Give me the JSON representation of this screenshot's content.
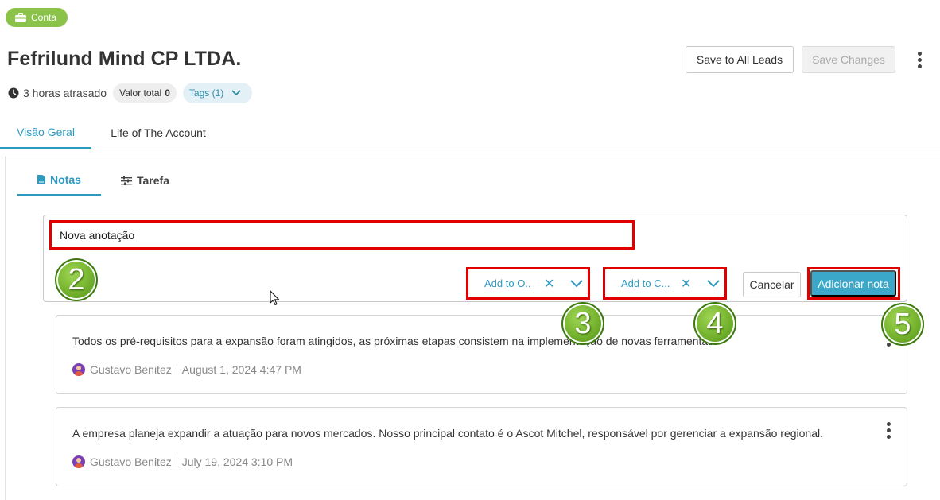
{
  "header": {
    "badge_label": "Conta",
    "title": "Fefrilund Mind CP LTDA.",
    "save_to_all_leads": "Save to All Leads",
    "save_changes": "Save Changes",
    "late_text": "3 horas atrasado",
    "valor_label": "Valor total",
    "valor_value": "0",
    "tags_label": "Tags (1)"
  },
  "main_tabs": [
    {
      "label": "Visão Geral",
      "active": true
    },
    {
      "label": "Life of The Account",
      "active": false
    }
  ],
  "sub_tabs": [
    {
      "label": "Notas",
      "active": true
    },
    {
      "label": "Tarefa",
      "active": false
    }
  ],
  "editor": {
    "value": "Nova anotação",
    "selector_o": "Add to O..",
    "selector_c": "Add to C...",
    "cancel": "Cancelar",
    "add_note": "Adicionar nota"
  },
  "markers": [
    "2",
    "3",
    "4",
    "5"
  ],
  "notes": [
    {
      "text": "Todos os pré-requisitos para a expansão foram atingidos, as próximas etapas consistem na implementação de novas ferramentas.",
      "author": "Gustavo Benitez",
      "date": "August 1, 2024 4:47 PM"
    },
    {
      "text": "A empresa planeja expandir a atuação para novos mercados. Nosso principal contato é o Ascot Mitchel, responsável por gerenciar a expansão regional.",
      "author": "Gustavo Benitez",
      "date": "July 19, 2024 3:10 PM"
    }
  ],
  "colors": {
    "accent": "#2f9ac0",
    "badge_green": "#8bc34a",
    "highlight_red": "#e00000",
    "primary_button": "#3ba7c9"
  }
}
